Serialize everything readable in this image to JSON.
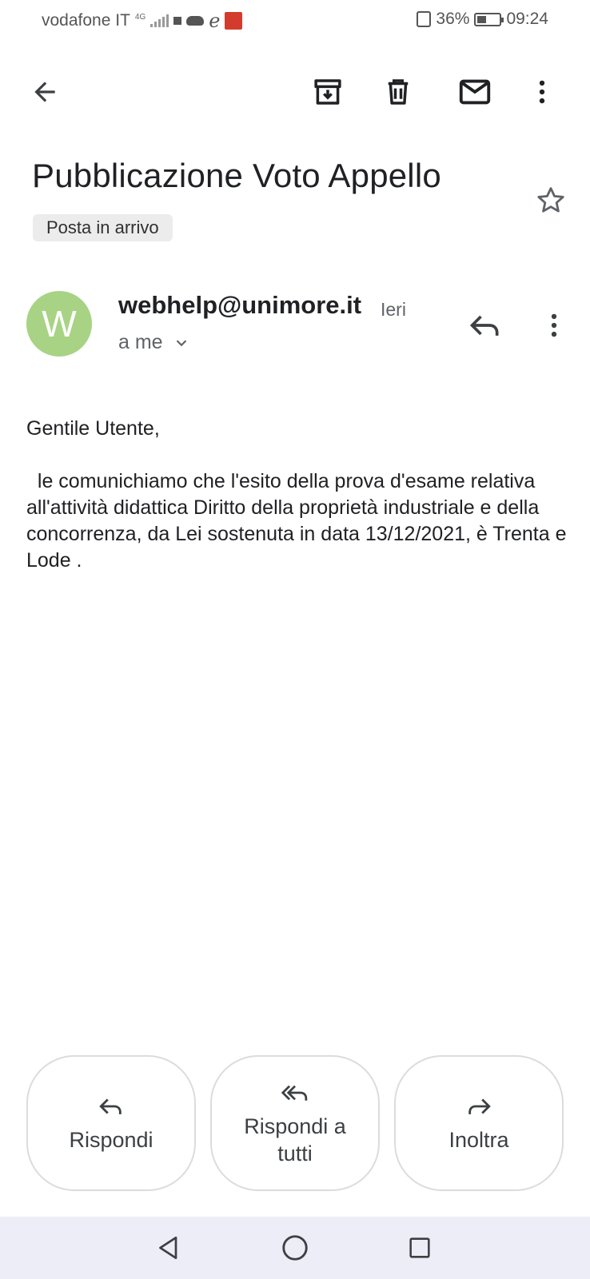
{
  "status_bar": {
    "carrier": "vodafone IT",
    "network": "4G",
    "battery": "36%",
    "time": "09:24"
  },
  "toolbar": {
    "icons": [
      "back-arrow-icon",
      "archive-icon",
      "delete-icon",
      "mark-unread-icon",
      "more-vert-icon"
    ]
  },
  "email": {
    "subject": "Pubblicazione Voto Appello",
    "label": "Posta in arrivo",
    "sender": {
      "initial": "W",
      "address": "webhelp@unimore.it",
      "time": "Ieri",
      "recipient": "a me",
      "avatar_color": "#a8d385"
    },
    "body": {
      "greeting": "Gentile Utente,",
      "text": "  le comunichiamo che l'esito della prova d'esame relativa all'attività didattica Diritto della proprietà industriale e della concorrenza, da Lei sostenuta in data 13/12/2021, è Trenta e Lode ."
    }
  },
  "actions": {
    "reply": "Rispondi",
    "reply_all": "Rispondi a tutti",
    "forward": "Inoltra"
  },
  "colors": {
    "text": "#202124",
    "secondary": "#5f6368",
    "chip_bg": "#ececec",
    "nav_bg": "#ecedf6"
  }
}
